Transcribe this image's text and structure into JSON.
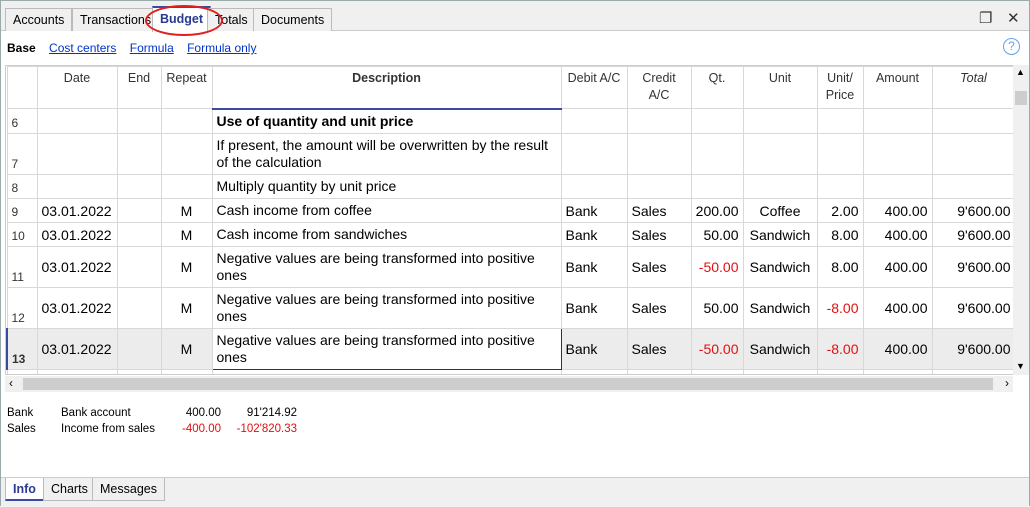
{
  "tabs": [
    "Accounts",
    "Transactions",
    "Budget",
    "Totals",
    "Documents"
  ],
  "active_tab": "Budget",
  "views": {
    "active": "Base",
    "links": [
      "Cost centers",
      "Formula",
      "Formula only"
    ]
  },
  "columns": [
    "",
    "Date",
    "End",
    "Repeat",
    "Description",
    "Debit A/C",
    "Credit A/C",
    "Qt.",
    "Unit",
    "Unit/ Price",
    "Amount",
    "Total"
  ],
  "rows": [
    {
      "n": "6",
      "date": "",
      "repeat": "",
      "desc": "Use of quantity and unit price",
      "bold": true,
      "debit": "",
      "credit": "",
      "qt": "",
      "unit": "",
      "price": "",
      "amount": "",
      "total": ""
    },
    {
      "n": "7",
      "date": "",
      "repeat": "",
      "desc": "If present, the amount will be overwritten by the result of the calculation",
      "debit": "",
      "credit": "",
      "qt": "",
      "unit": "",
      "price": "",
      "amount": "",
      "total": ""
    },
    {
      "n": "8",
      "date": "",
      "repeat": "",
      "desc": "Multiply quantity by unit price",
      "debit": "",
      "credit": "",
      "qt": "",
      "unit": "",
      "price": "",
      "amount": "",
      "total": ""
    },
    {
      "n": "9",
      "date": "03.01.2022",
      "repeat": "M",
      "desc": "Cash income from coffee",
      "debit": "Bank",
      "credit": "Sales",
      "qt": "200.00",
      "unit": "Coffee",
      "price": "2.00",
      "amount": "400.00",
      "total": "9'600.00"
    },
    {
      "n": "10",
      "date": "03.01.2022",
      "repeat": "M",
      "desc": "Cash income from sandwiches",
      "debit": "Bank",
      "credit": "Sales",
      "qt": "50.00",
      "unit": "Sandwich",
      "price": "8.00",
      "amount": "400.00",
      "total": "9'600.00"
    },
    {
      "n": "11",
      "date": "03.01.2022",
      "repeat": "M",
      "desc": "Negative values are being transformed into positive ones",
      "debit": "Bank",
      "credit": "Sales",
      "qt": "-50.00",
      "unit": "Sandwich",
      "price": "8.00",
      "amount": "400.00",
      "total": "9'600.00"
    },
    {
      "n": "12",
      "date": "03.01.2022",
      "repeat": "M",
      "desc": "Negative values are being transformed into positive ones",
      "debit": "Bank",
      "credit": "Sales",
      "qt": "50.00",
      "unit": "Sandwich",
      "price": "-8.00",
      "amount": "400.00",
      "total": "9'600.00"
    },
    {
      "n": "13",
      "date": "03.01.2022",
      "repeat": "M",
      "desc": "Negative values are being transformed into positive ones",
      "debit": "Bank",
      "credit": "Sales",
      "qt": "-50.00",
      "unit": "Sandwich",
      "price": "-8.00",
      "amount": "400.00",
      "total": "9'600.00",
      "selected": true
    }
  ],
  "info": [
    {
      "account": "Bank",
      "description": "Bank account",
      "amount": "400.00",
      "balance": "91'214.92"
    },
    {
      "account": "Sales",
      "description": "Income from sales",
      "amount": "-400.00",
      "balance": "-102'820.33"
    }
  ],
  "bottom_tabs": [
    "Info",
    "Charts",
    "Messages"
  ],
  "colors": {
    "accent": "#3a4aa0",
    "negative": "#e01010",
    "highlight": "#e02020"
  }
}
